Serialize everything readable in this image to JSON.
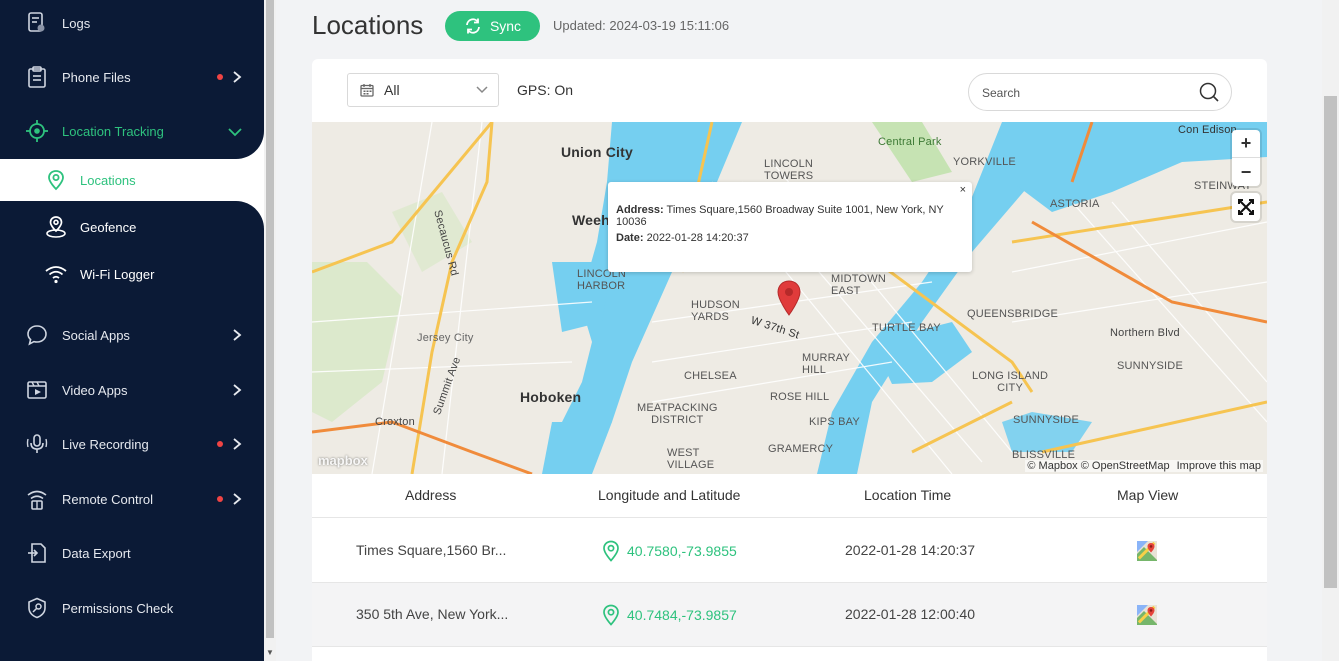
{
  "sidebar": {
    "items": [
      {
        "label": "Logs"
      },
      {
        "label": "Phone Files"
      },
      {
        "label": "Location Tracking"
      },
      {
        "label": "Social Apps"
      },
      {
        "label": "Video Apps"
      },
      {
        "label": "Live Recording"
      },
      {
        "label": "Remote Control"
      },
      {
        "label": "Data Export"
      },
      {
        "label": "Permissions Check"
      }
    ],
    "sub_items": [
      {
        "label": "Locations"
      },
      {
        "label": "Geofence"
      },
      {
        "label": "Wi-Fi Logger"
      }
    ],
    "accent_color": "#2ec27e",
    "badge_color": "#f04444"
  },
  "header": {
    "title": "Locations",
    "sync_label": "Sync",
    "updated": "Updated: 2024-03-19 15:11:06"
  },
  "filters": {
    "range_value": "All",
    "gps_status": "GPS: On",
    "search_placeholder": "Search"
  },
  "map": {
    "popup": {
      "address_label": "Address:",
      "address_value": "Times Square,1560 Broadway Suite 1001, New York, NY 10036",
      "date_label": "Date:",
      "date_value": "2022-01-28 14:20:37",
      "close": "×"
    },
    "attribution": "© Mapbox © OpenStreetMap",
    "improve": "Improve this map",
    "logo": "mapbox",
    "labels": {
      "union_city": "Union City",
      "weeh": "Weeh",
      "hoboken": "Hoboken",
      "central_park": "Central Park",
      "lincoln_towers": "LINCOLN\nTOWERS",
      "yorkville": "YORKVILLE",
      "astoria": "ASTORIA",
      "steinway": "STEINWAY",
      "midtown_east": "MIDTOWN\nEAST",
      "turtle_bay": "TURTLE BAY",
      "murray_hill": "MURRAY\nHILL",
      "chelsea": "CHELSEA",
      "rose_hill": "ROSE HILL",
      "kips_bay": "KIPS BAY",
      "gramercy": "GRAMERCY",
      "west_village": "WEST\nVILLAGE",
      "meatpacking": "MEATPACKING\nDISTRICT",
      "hudson_yards": "HUDSON\nYARDS",
      "lincoln_harbor": "LINCOLN\nHARBOR",
      "queensbridge": "QUEENSBRIDGE",
      "long_island_city": "LONG ISLAND\nCITY",
      "sunnyside": "SUNNYSIDE",
      "blissville": "BLISSVILLE",
      "northern_blvd": "Northern Blvd",
      "jersey_city": "Jersey City",
      "secaucus_rd": "Secaucus Rd",
      "summit_ave": "Summit Ave",
      "croxton": "Croxton",
      "w37th": "W 37th St",
      "con_edison": "Con Edison"
    }
  },
  "table": {
    "headers": [
      "Address",
      "Longitude and Latitude",
      "Location Time",
      "Map View"
    ],
    "rows": [
      {
        "address": "Times Square,1560 Br...",
        "coords": "40.7580,-73.9855",
        "time": "2022-01-28 14:20:37"
      },
      {
        "address": "350 5th Ave, New York...",
        "coords": "40.7484,-73.9857",
        "time": "2022-01-28 12:00:40"
      }
    ]
  }
}
